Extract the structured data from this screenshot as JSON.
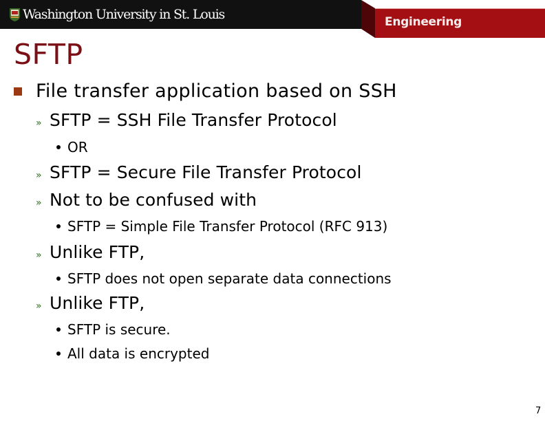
{
  "header": {
    "university": "Washington University in St. Louis",
    "school": "Engineering",
    "colors": {
      "bar": "#111111",
      "band": "#a30f12",
      "fold": "#4d0507",
      "title": "#7a1016",
      "level1_bullet": "#9b3a12",
      "level2_bullet": "#2e6b1c"
    }
  },
  "slide": {
    "title": "SFTP",
    "bullets": [
      {
        "level": 1,
        "text": "File transfer application based on SSH"
      },
      {
        "level": 2,
        "text": "SFTP = SSH File Transfer Protocol"
      },
      {
        "level": 3,
        "text": "OR"
      },
      {
        "level": 2,
        "text": "SFTP = Secure File Transfer Protocol"
      },
      {
        "level": 2,
        "text": "Not to be confused with"
      },
      {
        "level": 3,
        "text": "SFTP = Simple File Transfer Protocol (RFC 913)"
      },
      {
        "level": 2,
        "text": "Unlike FTP,"
      },
      {
        "level": 3,
        "text": "SFTP does not open separate data connections"
      },
      {
        "level": 2,
        "text": "Unlike FTP,"
      },
      {
        "level": 3,
        "text": "SFTP is secure."
      },
      {
        "level": 3,
        "text": "All data is encrypted"
      }
    ],
    "bullet_glyphs": {
      "level1": "square-bullet-icon",
      "level2": "»",
      "level3": "round-bullet-icon"
    },
    "page_number": "7"
  }
}
